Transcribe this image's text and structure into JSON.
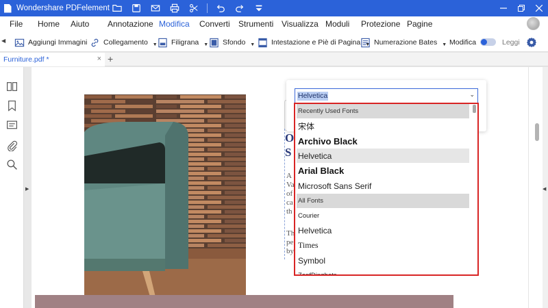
{
  "window": {
    "title": "Wondershare PDFelement",
    "accent": "#2b62d9"
  },
  "title_icons": [
    "folder-icon",
    "save-icon",
    "mail-icon",
    "print-icon",
    "scissors-icon",
    "undo-icon",
    "redo-icon",
    "quick-access-dropdown-icon"
  ],
  "menu": {
    "items": [
      "File",
      "Home",
      "Aiuto",
      "Annotazione",
      "Modifica",
      "Converti",
      "Strumenti",
      "Visualizza",
      "Moduli",
      "Protezione",
      "Pagine"
    ],
    "active": "Modifica"
  },
  "toolbar": {
    "add_images": "Aggiungi Immagini",
    "link": "Collegamento",
    "watermark": "Filigrana",
    "background": "Sfondo",
    "header_footer": "Intestazione e Piè di Pagina",
    "bates": "Numerazione Bates",
    "edit_mode": "Modifica",
    "read_mode": "Leggi",
    "toggle_state": "Modifica"
  },
  "tabs": {
    "document": "Furniture.pdf *",
    "close": "×",
    "add": "+"
  },
  "sidebar_icons": [
    "thumbnails-icon",
    "bookmark-icon",
    "comment-icon",
    "attachment-icon",
    "search-icon"
  ],
  "document": {
    "heading_lines": [
      "O",
      "S"
    ],
    "para1_lines": [
      "A",
      "Va",
      "of",
      "ca",
      "th"
    ],
    "para2_lines": [
      "Th",
      "pe",
      "by"
    ]
  },
  "font_picker": {
    "selected": "Helvetica",
    "chevron": "⌄",
    "items": [
      {
        "label": "Recently Used Fonts",
        "kind": "header"
      },
      {
        "label": "宋体",
        "kind": "font"
      },
      {
        "label": "Archivo Black",
        "kind": "font"
      },
      {
        "label": "Helvetica",
        "kind": "font",
        "highlighted": true
      },
      {
        "label": "Arial Black",
        "kind": "font"
      },
      {
        "label": "Microsoft Sans Serif",
        "kind": "font"
      },
      {
        "label": "All Fonts",
        "kind": "header"
      },
      {
        "label": "Courier",
        "kind": "font"
      },
      {
        "label": "Helvetica",
        "kind": "font"
      },
      {
        "label": "Times",
        "kind": "font"
      },
      {
        "label": "Symbol",
        "kind": "font"
      },
      {
        "label": "ZapfDingbats",
        "kind": "font"
      }
    ],
    "highlight_color": "#d82424"
  }
}
